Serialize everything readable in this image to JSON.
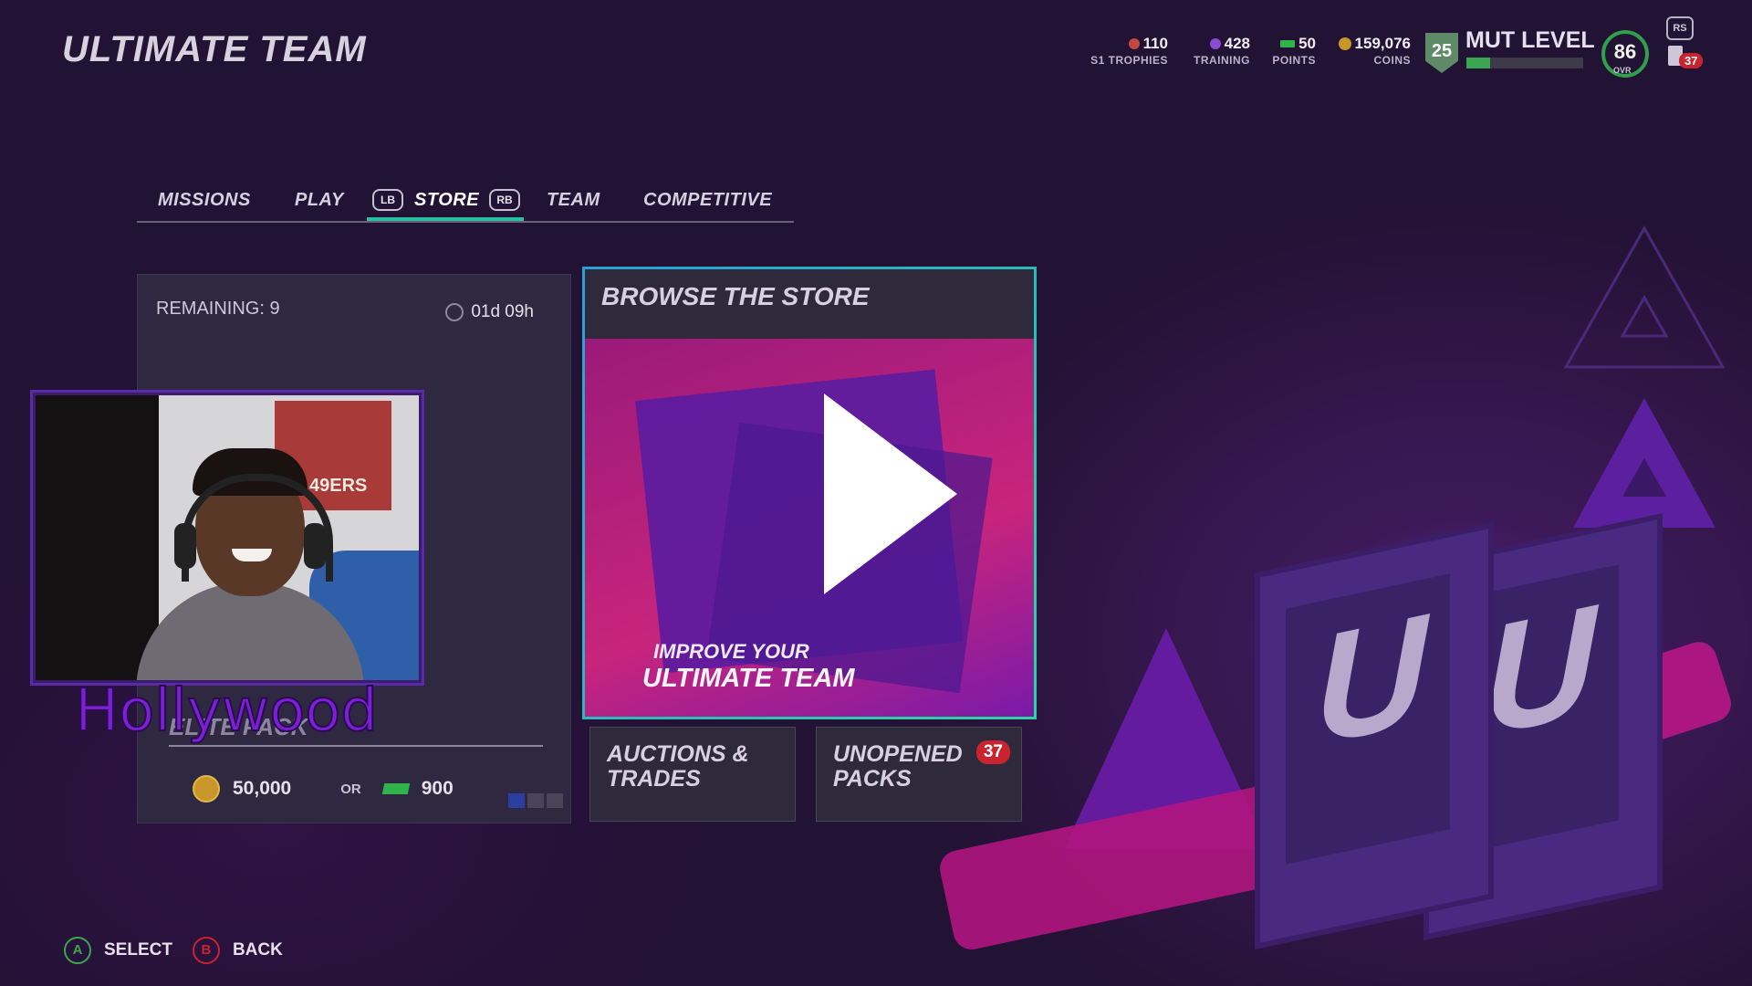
{
  "header": {
    "title": "ULTIMATE TEAM",
    "stats": [
      {
        "value": "110",
        "label": "S1 TROPHIES",
        "color": "#c0483c"
      },
      {
        "value": "428",
        "label": "TRAINING",
        "color": "#8a4bd6"
      },
      {
        "value": "50",
        "label": "POINTS",
        "color": "#2fb34a"
      },
      {
        "value": "159,076",
        "label": "COINS",
        "color": "#c9962c"
      }
    ],
    "level_number": "25",
    "mut_level_label": "MUT LEVEL",
    "mut_level_progress": 0.2,
    "ovr_value": "86",
    "ovr_label": "OVR",
    "rs_label": "RS",
    "notification_count": "37"
  },
  "tabs": {
    "items": [
      "MISSIONS",
      "PLAY",
      "STORE",
      "TEAM",
      "COMPETITIVE"
    ],
    "active": "STORE",
    "lb": "LB",
    "rb": "RB"
  },
  "featured_pack": {
    "remaining_label": "REMAINING:",
    "remaining_value": "9",
    "timer": "01d 09h",
    "name": "ELITE PACK",
    "coin_price": "50,000",
    "or_label": "OR",
    "points_price": "900",
    "pager_total": 3,
    "pager_active": 0
  },
  "streamer": {
    "name": "Hollywood",
    "poster_text": "49ERS"
  },
  "browse_store": {
    "title": "BROWSE THE STORE",
    "line1": "IMPROVE YOUR",
    "line2": "ULTIMATE TEAM"
  },
  "tiles": {
    "auctions": "AUCTIONS & TRADES",
    "unopened": "UNOPENED PACKS",
    "unopened_count": "37"
  },
  "footer": {
    "select_key": "A",
    "select_label": "SELECT",
    "back_key": "B",
    "back_label": "BACK"
  },
  "colors": {
    "accent": "#2abfa0",
    "background": "#221233",
    "badge": "#c8232f",
    "a_button": "#3aa64f",
    "b_button": "#c8232f"
  }
}
